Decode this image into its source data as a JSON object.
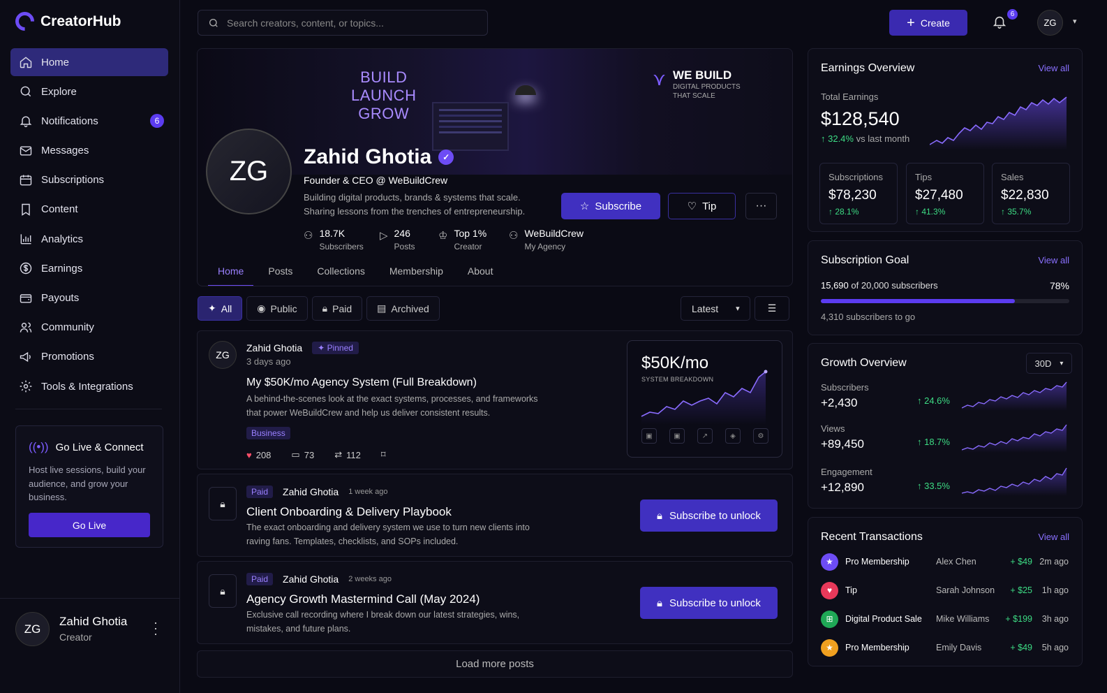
{
  "brand": {
    "name": "CreatorHub"
  },
  "nav": [
    {
      "label": "Home",
      "icon": "home-icon",
      "active": true
    },
    {
      "label": "Explore",
      "icon": "search-icon"
    },
    {
      "label": "Notifications",
      "icon": "bell-icon",
      "badge": "6"
    },
    {
      "label": "Messages",
      "icon": "mail-icon"
    },
    {
      "label": "Subscriptions",
      "icon": "calendar-icon"
    },
    {
      "label": "Content",
      "icon": "bookmark-icon"
    },
    {
      "label": "Analytics",
      "icon": "bar-chart-icon"
    },
    {
      "label": "Earnings",
      "icon": "dollar-icon"
    },
    {
      "label": "Payouts",
      "icon": "wallet-icon"
    },
    {
      "label": "Community",
      "icon": "users-icon"
    },
    {
      "label": "Promotions",
      "icon": "megaphone-icon"
    },
    {
      "label": "Tools & Integrations",
      "icon": "tools-icon"
    }
  ],
  "golive": {
    "title": "Go Live & Connect",
    "description": "Host live sessions, build your audience, and grow your business.",
    "button": "Go Live"
  },
  "user": {
    "initials": "ZG",
    "name": "Zahid Ghotia",
    "role": "Creator"
  },
  "topbar": {
    "search_placeholder": "Search creators, content, or topics...",
    "create_label": "Create",
    "notif_count": "6",
    "avatar_initials": "ZG"
  },
  "banner": {
    "lines": [
      "BUILD",
      "LAUNCH",
      "GROW"
    ],
    "we_title": "WE BUILD",
    "we_sub": "DIGITAL PRODUCTS THAT SCALE"
  },
  "profile": {
    "initials": "ZG",
    "name": "Zahid Ghotia",
    "tagline": "Founder & CEO @ WeBuildCrew",
    "bio": "Building digital products, brands & systems that scale. Sharing lessons from the trenches of entrepreneurship.",
    "subscribe_label": "Subscribe",
    "tip_label": "Tip",
    "stats": [
      {
        "value": "18.7K",
        "label": "Subscribers",
        "icon": "user-icon"
      },
      {
        "value": "246",
        "label": "Posts",
        "icon": "play-icon"
      },
      {
        "value": "Top 1%",
        "label": "Creator",
        "icon": "crown-icon"
      },
      {
        "value": "WeBuildCrew",
        "label": "My Agency",
        "icon": "agency-icon"
      }
    ],
    "tabs": [
      "Home",
      "Posts",
      "Collections",
      "Membership",
      "About"
    ]
  },
  "filters": {
    "items": [
      "All",
      "Public",
      "Paid",
      "Archived"
    ],
    "sort": "Latest"
  },
  "pinned_post": {
    "initials": "ZG",
    "author": "Zahid Ghotia",
    "pinned_label": "Pinned",
    "time": "3 days ago",
    "title": "My $50K/mo Agency System (Full Breakdown)",
    "description": "A behind-the-scenes look at the exact systems, processes, and frameworks that power WeBuildCrew and help us deliver consistent results.",
    "tag": "Business",
    "likes": "208",
    "comments": "73",
    "reposts": "112",
    "preview_title": "$50K/mo",
    "preview_sub": "SYSTEM BREAKDOWN"
  },
  "locked_posts": [
    {
      "badge": "Paid",
      "author": "Zahid Ghotia",
      "time": "1 week ago",
      "title": "Client Onboarding & Delivery Playbook",
      "description": "The exact onboarding and delivery system we use to turn new clients into raving fans. Templates, checklists, and SOPs included.",
      "button": "Subscribe to unlock"
    },
    {
      "badge": "Paid",
      "author": "Zahid Ghotia",
      "time": "2 weeks ago",
      "title": "Agency Growth Mastermind Call (May 2024)",
      "description": "Exclusive call recording where I break down our latest strategies, wins, mistakes, and future plans.",
      "button": "Subscribe to unlock"
    }
  ],
  "load_more": "Load more posts",
  "earnings": {
    "title": "Earnings Overview",
    "view_all": "View all",
    "total_label": "Total Earnings",
    "total_value": "$128,540",
    "change": "↑ 32.4%",
    "change_suffix": "vs last month",
    "minis": [
      {
        "label": "Subscriptions",
        "value": "$78,230",
        "change": "↑ 28.1%"
      },
      {
        "label": "Tips",
        "value": "$27,480",
        "change": "↑ 41.3%"
      },
      {
        "label": "Sales",
        "value": "$22,830",
        "change": "↑ 35.7%"
      }
    ]
  },
  "goal": {
    "title": "Subscription Goal",
    "view_all": "View all",
    "current": "15,690",
    "of_text": "of 20,000 subscribers",
    "percent_label": "78%",
    "progress": 0.78,
    "remaining": "4,310 subscribers to go"
  },
  "growth": {
    "title": "Growth Overview",
    "period": "30D",
    "metrics": [
      {
        "label": "Subscribers",
        "value": "+2,430",
        "change": "↑ 24.6%"
      },
      {
        "label": "Views",
        "value": "+89,450",
        "change": "↑ 18.7%"
      },
      {
        "label": "Engagement",
        "value": "+12,890",
        "change": "↑ 33.5%"
      }
    ]
  },
  "transactions": {
    "title": "Recent Transactions",
    "view_all": "View all",
    "rows": [
      {
        "type": "Pro Membership",
        "name": "Alex Chen",
        "amount": "+ $49",
        "time": "2m ago",
        "icon": "star-icon",
        "color": "#6d4cf5"
      },
      {
        "type": "Tip",
        "name": "Sarah Johnson",
        "amount": "+ $25",
        "time": "1h ago",
        "icon": "heart-icon",
        "color": "#e8395a"
      },
      {
        "type": "Digital Product Sale",
        "name": "Mike Williams",
        "amount": "+ $199",
        "time": "3h ago",
        "icon": "cart-icon",
        "color": "#1fa856"
      },
      {
        "type": "Pro Membership",
        "name": "Emily Davis",
        "amount": "+ $49",
        "time": "5h ago",
        "icon": "star-icon",
        "color": "#f0a020"
      }
    ]
  },
  "colors": {
    "accent": "#6d4cf5",
    "positive": "#3ddc84",
    "background": "#0a0a14"
  }
}
